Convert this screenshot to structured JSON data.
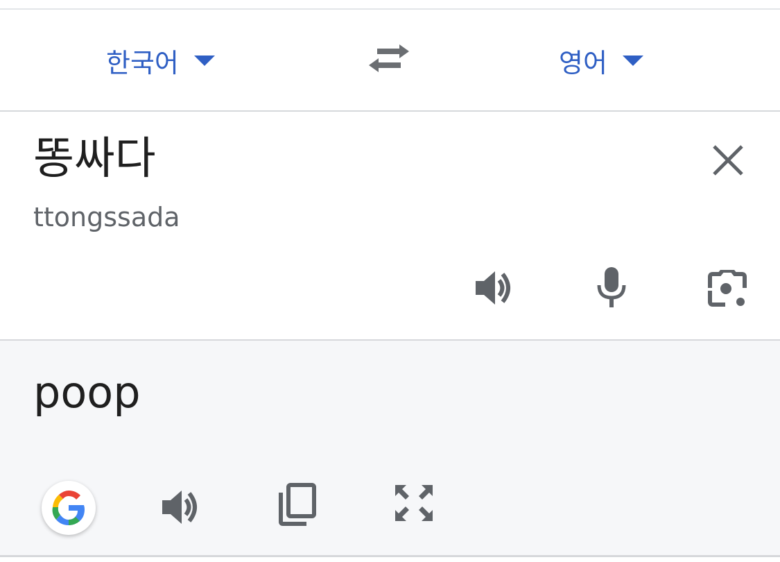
{
  "languages": {
    "source": "한국어",
    "target": "영어"
  },
  "source_panel": {
    "text": "똥싸다",
    "romanization": "ttongssada"
  },
  "target_panel": {
    "text": "poop"
  },
  "icons": {
    "swap": "swap-arrows-icon",
    "clear": "close-icon",
    "source_listen": "speaker-icon",
    "mic": "microphone-icon",
    "camera": "camera-icon",
    "google": "google-g-icon",
    "target_listen": "speaker-icon",
    "copy": "copy-icon",
    "fullscreen": "fullscreen-icon"
  },
  "colors": {
    "accent": "#2f5fc4",
    "icon_gray": "#5f6368",
    "text": "#1f1f1f",
    "output_bg": "#f6f7f9"
  }
}
